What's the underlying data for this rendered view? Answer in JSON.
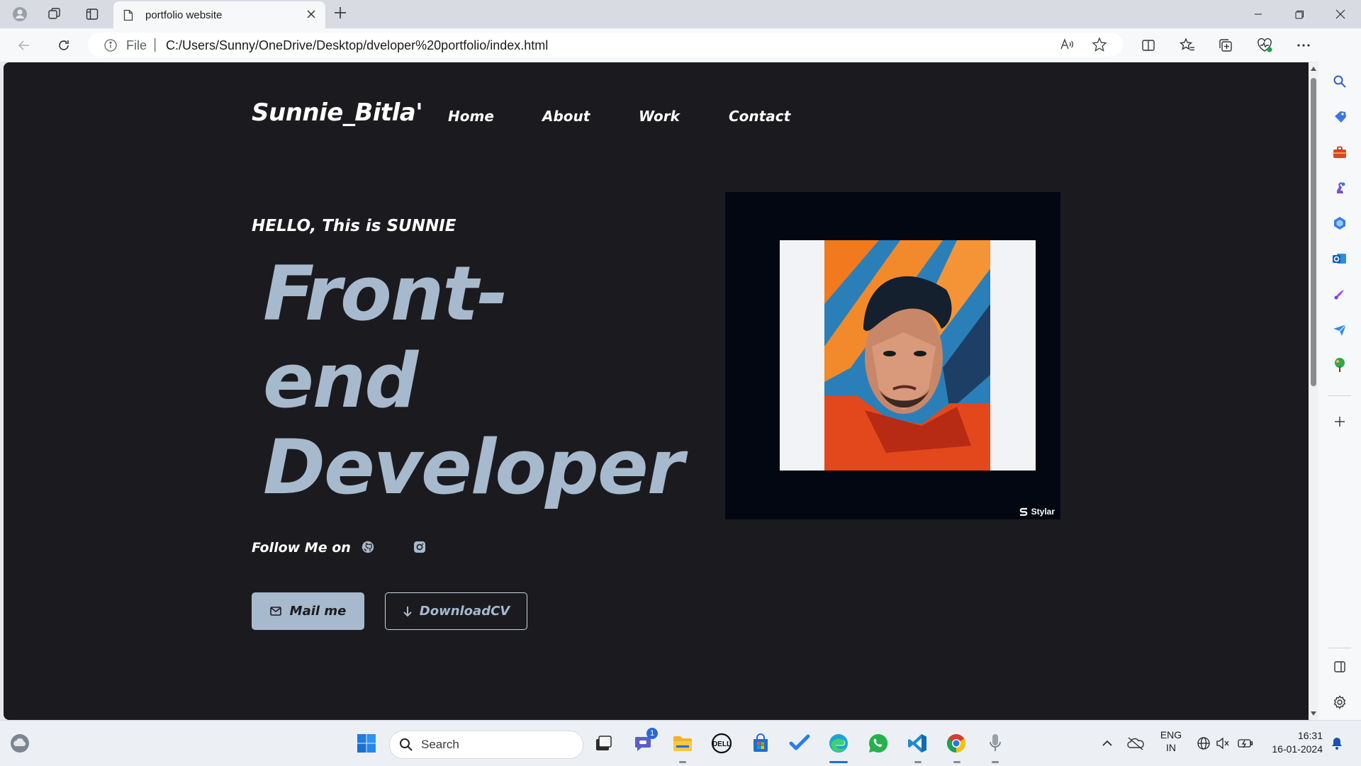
{
  "browser": {
    "tab_title": "portfolio website",
    "url_scheme": "File",
    "url": "C:/Users/Sunny/OneDrive/Desktop/dveloper%20portfolio/index.html"
  },
  "site": {
    "logo": "Sunnie_Bitla'",
    "nav": [
      "Home",
      "About",
      "Work",
      "Contact"
    ],
    "greeting": "HELLO, This is SUNNIE",
    "hero": [
      "Front-",
      "end",
      "Developer"
    ],
    "follow_label": "Follow Me on",
    "mail_button": "Mail me",
    "cv_button": "DownloadCV",
    "watermark": "Stylar"
  },
  "taskbar": {
    "search_placeholder": "Search",
    "teams_badge": "1",
    "lang_top": "ENG",
    "lang_bottom": "IN",
    "time": "16:31",
    "date": "16-01-2024"
  },
  "colors": {
    "page_bg": "#1b1b1f",
    "accent": "#a7b9cd",
    "portrait_frame": "#030711"
  }
}
